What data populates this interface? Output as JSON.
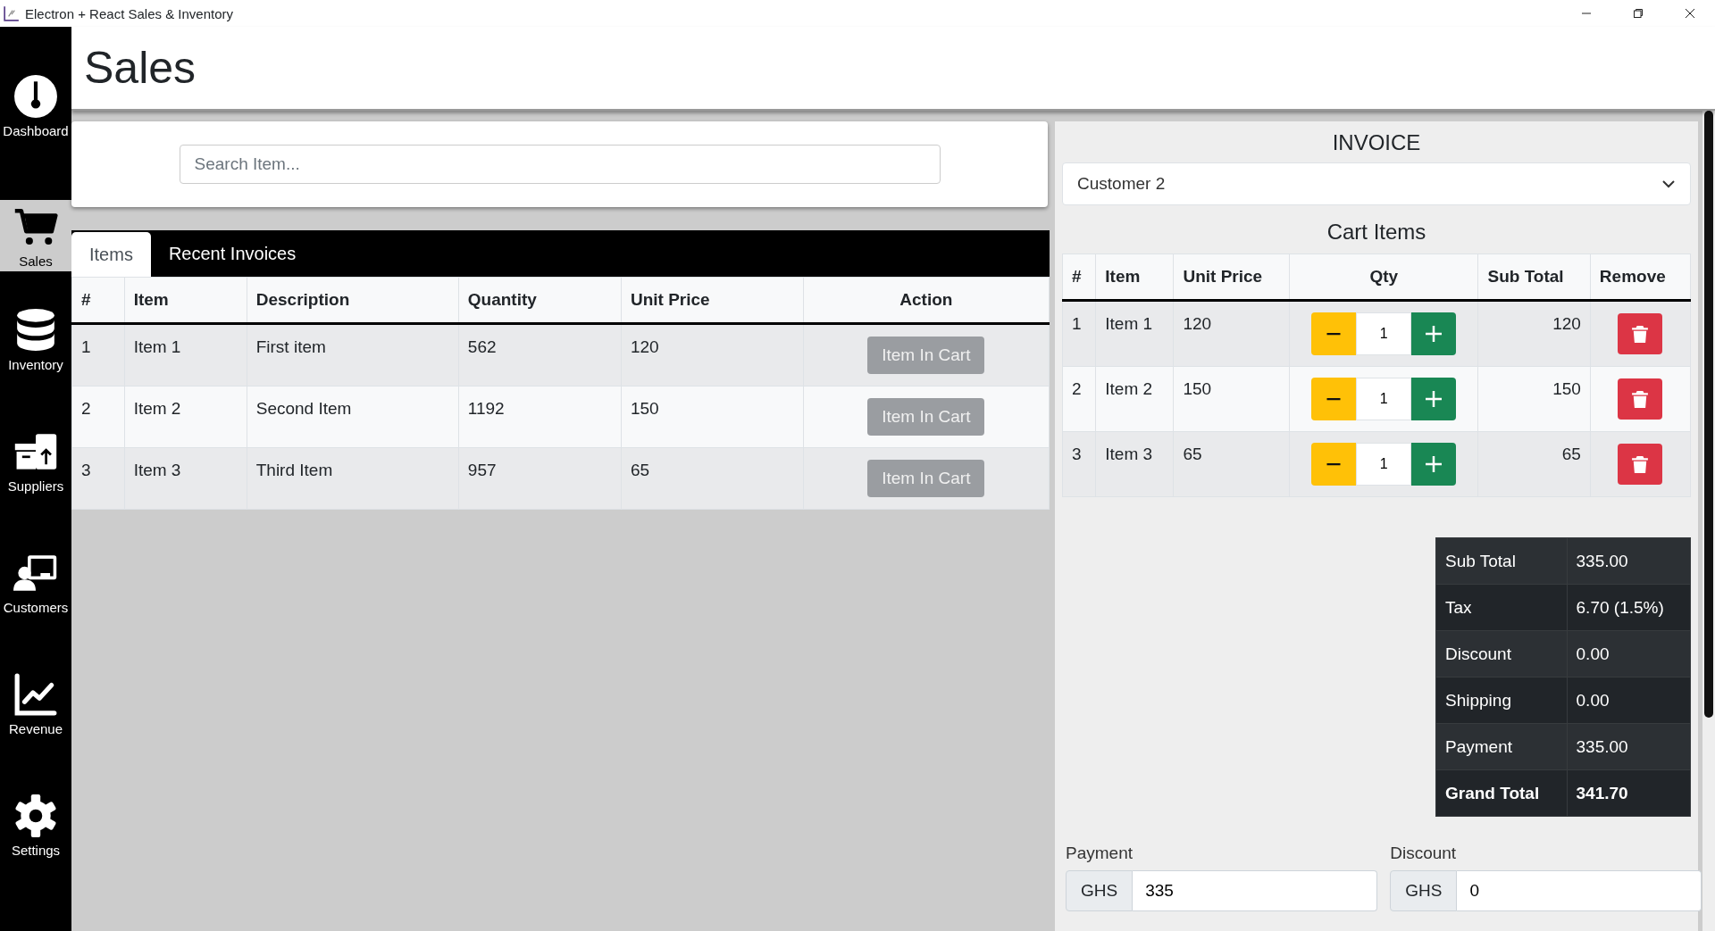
{
  "window": {
    "title": "Electron + React Sales & Inventory"
  },
  "sidebar": {
    "items": [
      {
        "label": "Dashboard",
        "kind": "gauge",
        "selected": false
      },
      {
        "label": "Sales",
        "kind": "cart",
        "selected": true
      },
      {
        "label": "Inventory",
        "kind": "database",
        "selected": false
      },
      {
        "label": "Suppliers",
        "kind": "boxes",
        "selected": false
      },
      {
        "label": "Customers",
        "kind": "presenter",
        "selected": false
      },
      {
        "label": "Revenue",
        "kind": "chart",
        "selected": false
      },
      {
        "label": "Settings",
        "kind": "gear",
        "selected": false
      }
    ]
  },
  "page_title": "Sales",
  "search": {
    "placeholder": "Search Item..."
  },
  "tabs": [
    {
      "label": "Items",
      "selected": true
    },
    {
      "label": "Recent Invoices",
      "selected": false
    }
  ],
  "items_table": {
    "columns": [
      "#",
      "Item",
      "Description",
      "Quantity",
      "Unit Price",
      "Action"
    ],
    "rows": [
      {
        "cells": [
          "1",
          "Item 1",
          "First item",
          "562",
          "120"
        ],
        "action": {
          "label": "Item In Cart",
          "disabled": true
        }
      },
      {
        "cells": [
          "2",
          "Item 2",
          "Second Item",
          "1192",
          "150"
        ],
        "action": {
          "label": "Item In Cart",
          "disabled": true
        }
      },
      {
        "cells": [
          "3",
          "Item 3",
          "Third Item",
          "957",
          "65"
        ],
        "action": {
          "label": "Item In Cart",
          "disabled": true
        }
      }
    ]
  },
  "invoice": {
    "title": "INVOICE",
    "customer": "Customer 2",
    "cart_title": "Cart Items",
    "columns": [
      "#",
      "Item",
      "Unit Price",
      "Qty",
      "Sub Total",
      "Remove"
    ],
    "rows": [
      {
        "index": "1",
        "item": "Item 1",
        "unit_price": "120",
        "qty": "1",
        "sub_total": "120"
      },
      {
        "index": "2",
        "item": "Item 2",
        "unit_price": "150",
        "qty": "1",
        "sub_total": "150"
      },
      {
        "index": "3",
        "item": "Item 3",
        "unit_price": "65",
        "qty": "1",
        "sub_total": "65"
      }
    ],
    "totals": [
      {
        "label": "Sub Total",
        "value": "335.00",
        "emphasis": false
      },
      {
        "label": "Tax",
        "value": "6.70 (1.5%)",
        "emphasis": false
      },
      {
        "label": "Discount",
        "value": "0.00",
        "emphasis": false
      },
      {
        "label": "Shipping",
        "value": "0.00",
        "emphasis": false
      },
      {
        "label": "Payment",
        "value": "335.00",
        "emphasis": false
      },
      {
        "label": "Grand Total",
        "value": "341.70",
        "emphasis": true
      }
    ],
    "fields": [
      {
        "label": "Payment",
        "prefix": "GHS",
        "value": "335"
      },
      {
        "label": "Discount",
        "prefix": "GHS",
        "value": "0"
      }
    ]
  }
}
